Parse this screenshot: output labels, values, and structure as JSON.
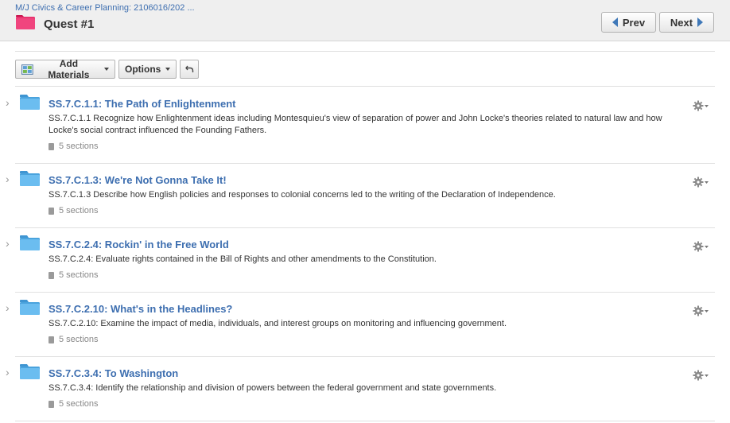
{
  "header": {
    "breadcrumb": "M/J Civics & Career Planning: 2106016/202 ...",
    "title": "Quest #1",
    "prev_label": "Prev",
    "next_label": "Next",
    "folder_color": "#e8336e"
  },
  "toolbar": {
    "add_materials_label": "Add Materials",
    "options_label": "Options",
    "undo_icon": "undo-icon"
  },
  "items": [
    {
      "title": "SS.7.C.1.1: The Path of Enlightenment",
      "description": "SS.7.C.1.1 Recognize how Enlightenment ideas including Montesquieu's view of separation of power and John Locke's theories related to natural law and how Locke's social contract influenced the Founding Fathers.",
      "sections": "5 sections"
    },
    {
      "title": "SS.7.C.1.3: We're Not Gonna Take It!",
      "description": "SS.7.C.1.3 Describe how English policies and responses to colonial concerns led to the writing of the Declaration of Independence.",
      "sections": "5 sections"
    },
    {
      "title": "SS.7.C.2.4: Rockin' in the Free World",
      "description": "SS.7.C.2.4: Evaluate rights contained in the Bill of Rights and other amendments to the Constitution.",
      "sections": "5 sections"
    },
    {
      "title": "SS.7.C.2.10: What's in the Headlines?",
      "description": "SS.7.C.2.10: Examine the impact of media, individuals, and interest groups on monitoring and influencing government.",
      "sections": "5 sections"
    },
    {
      "title": "SS.7.C.3.4: To Washington",
      "description": "SS.7.C.3.4: Identify the relationship and division of powers between the federal government and state governments.",
      "sections": "5 sections"
    }
  ],
  "colors": {
    "link": "#3e6fb0",
    "folder_blue": "#5aaee3"
  }
}
